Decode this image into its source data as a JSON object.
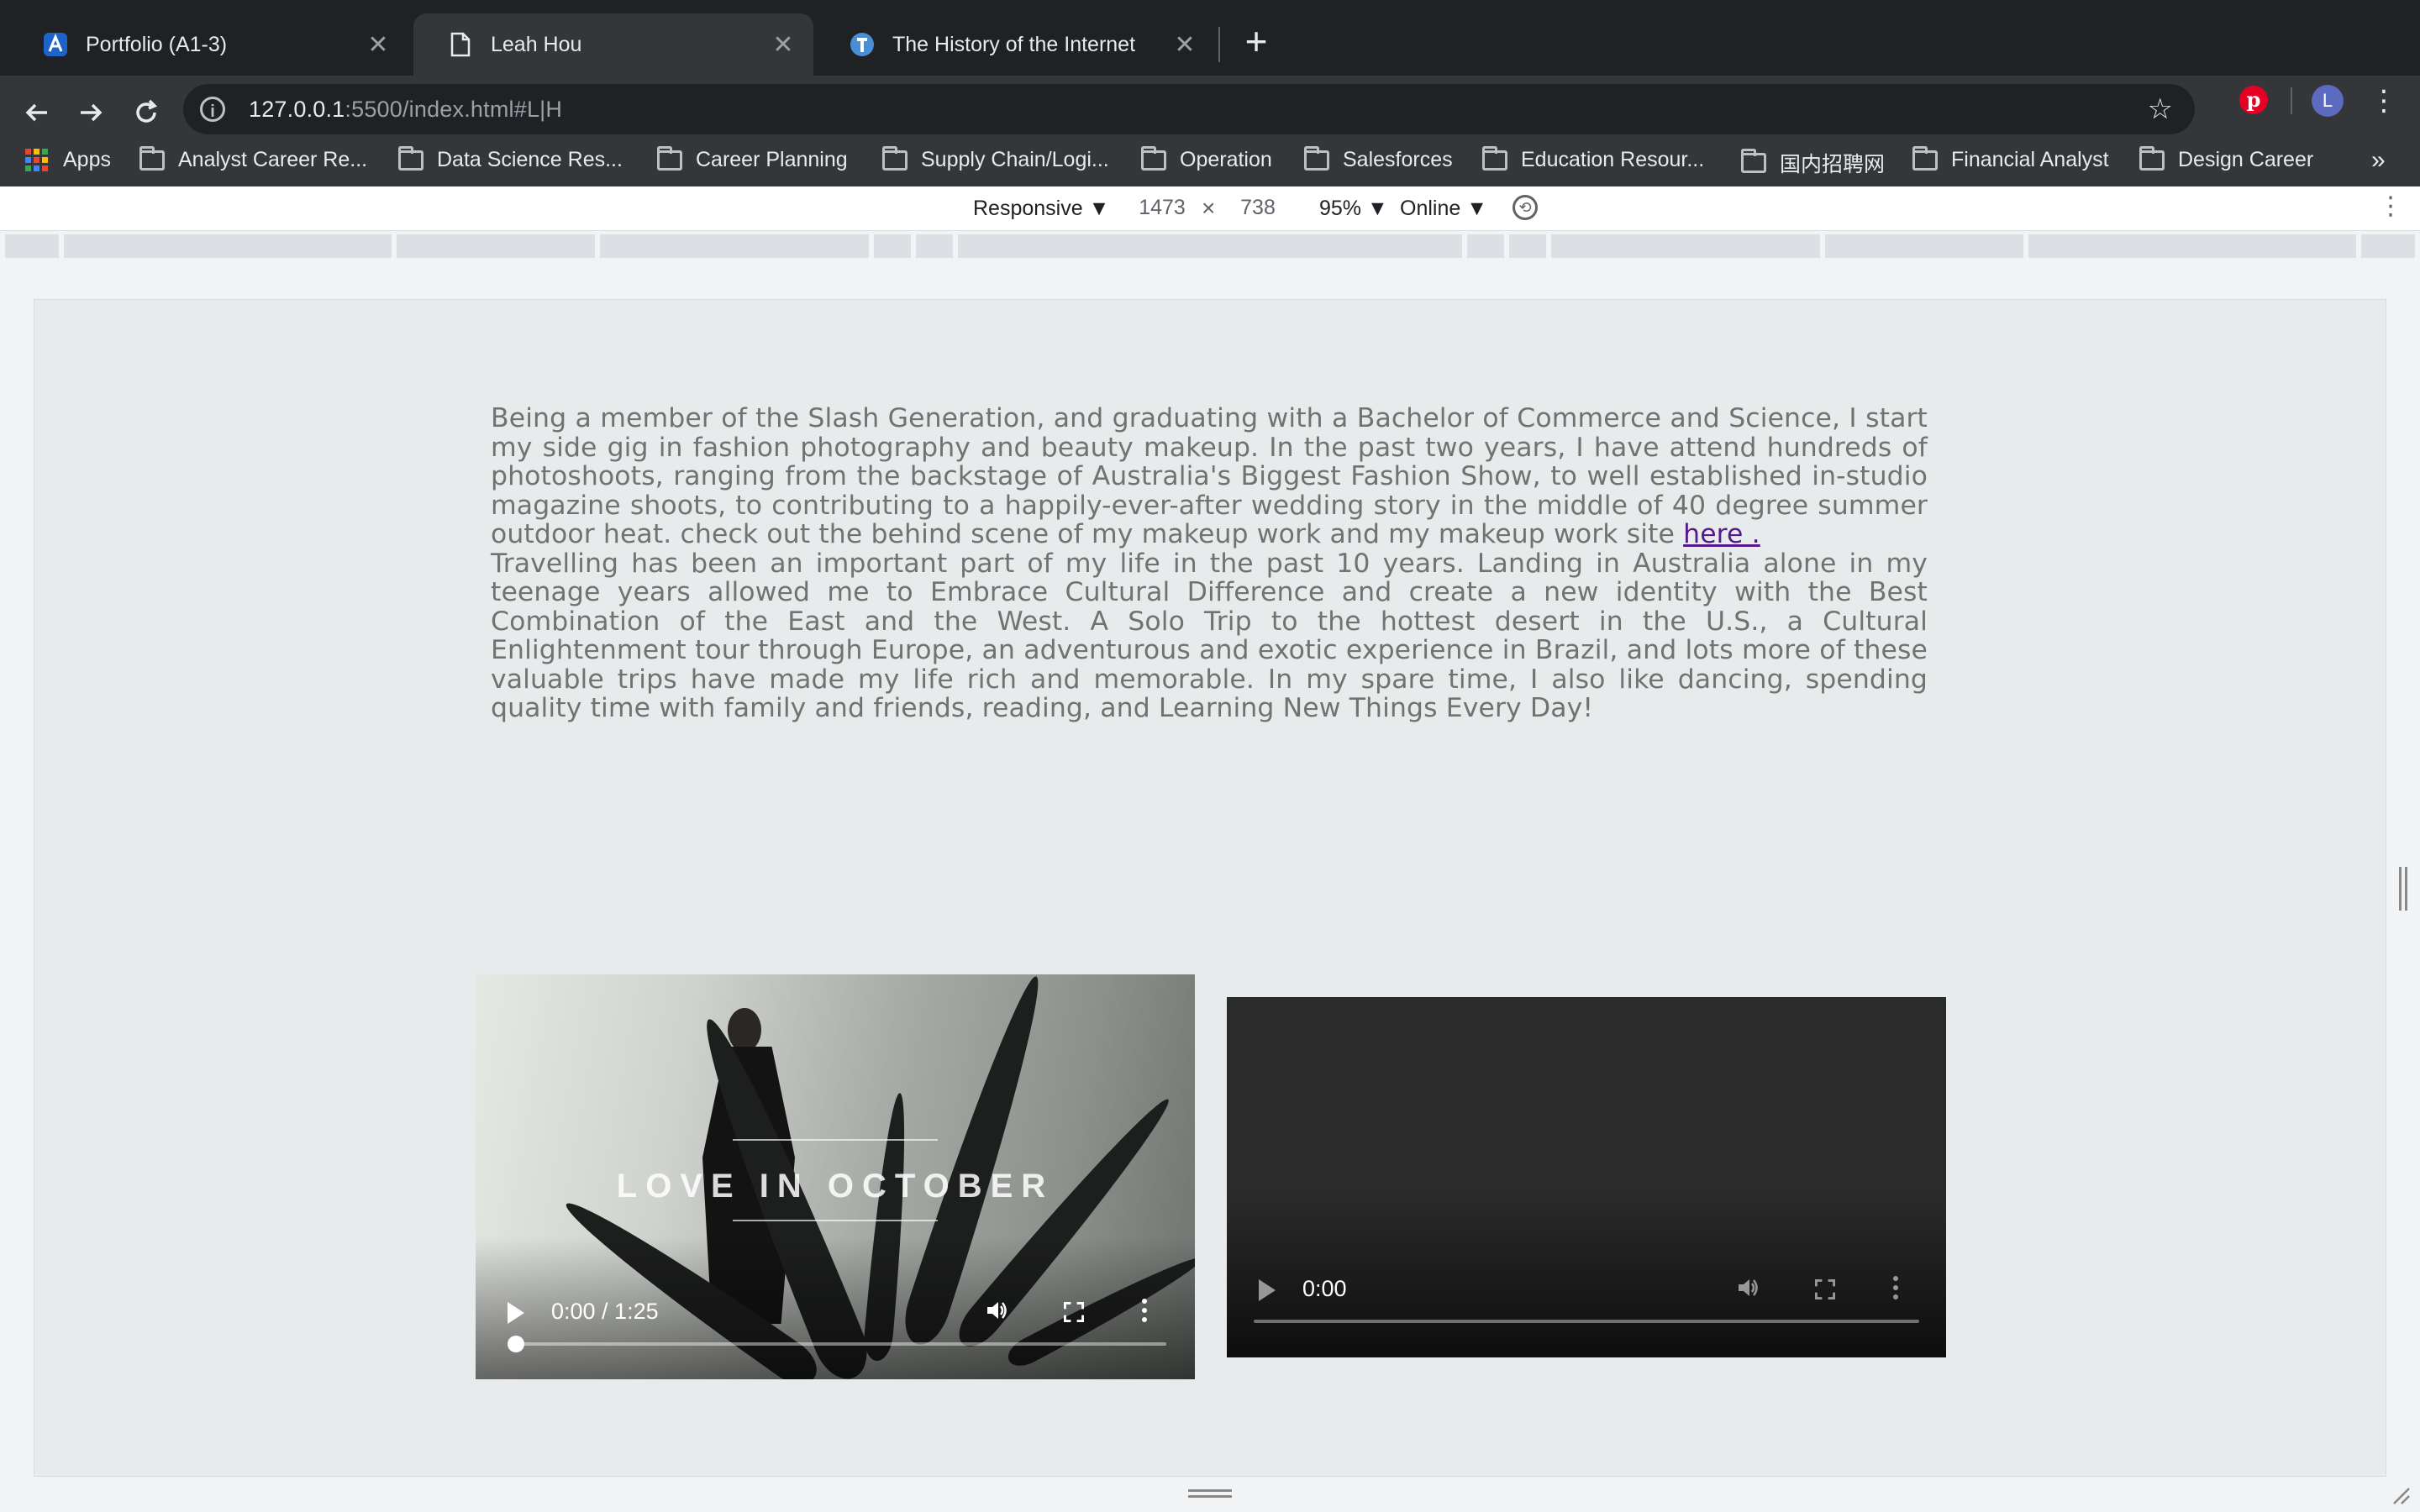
{
  "browser": {
    "tabs": [
      {
        "title": "Portfolio (A1-3)",
        "icon": "portfolio-favicon",
        "active": false
      },
      {
        "title": "Leah Hou",
        "icon": "document-icon",
        "active": true
      },
      {
        "title": "The History of the Internet",
        "icon": "site-favicon",
        "active": false
      }
    ],
    "url_host": "127.0.0.1",
    "url_rest": ":5500/index.html#L|H",
    "profile_initial": "L",
    "bookmarks": [
      {
        "label": "Apps",
        "icon": "apps-grid-icon"
      },
      {
        "label": "Analyst Career Re...",
        "icon": "folder-icon"
      },
      {
        "label": "Data Science Res...",
        "icon": "folder-icon"
      },
      {
        "label": "Career Planning",
        "icon": "folder-icon"
      },
      {
        "label": "Supply Chain/Logi...",
        "icon": "folder-icon"
      },
      {
        "label": "Operation",
        "icon": "folder-icon"
      },
      {
        "label": "Salesforces",
        "icon": "folder-icon"
      },
      {
        "label": "Education Resour...",
        "icon": "folder-icon"
      },
      {
        "label": "国内招聘网",
        "icon": "folder-icon"
      },
      {
        "label": "Financial Analyst",
        "icon": "folder-icon"
      },
      {
        "label": "Design Career",
        "icon": "folder-icon"
      }
    ],
    "bookmarks_more": "»"
  },
  "devtools": {
    "device": "Responsive ▼",
    "width": "1473",
    "times": "×",
    "height": "738",
    "zoom": "95% ▼",
    "network": "Online ▼"
  },
  "page": {
    "bio_p1": " Being a member of the Slash Generation, and graduating with a Bachelor of Commerce and Science, I start my side gig in fashion photography and beauty makeup. In the past two years, I have attend hundreds of photoshoots, ranging from the backstage of Australia's Biggest Fashion Show, to well established in-studio magazine shoots, to contributing to a happily-ever-after wedding story in the middle of 40 degree summer outdoor heat. check out the behind scene of my makeup work and my makeup work site ",
    "bio_link": "here .",
    "bio_p2": "Travelling has been an important part of my life in the past 10 years. Landing in Australia alone in my teenage years allowed me to Embrace Cultural Difference and create a new identity with the Best Combination of the East and the West. A Solo Trip to the hottest desert in the U.S., a Cultural Enlightenment tour through Europe, an adventurous and exotic experience in Brazil, and lots more of these valuable trips have made my life rich and memorable. In my spare time, I also like dancing, spending quality time with family and friends, reading, and Learning New Things Every Day!",
    "video1": {
      "overlay_title": "LOVE IN OCTOBER",
      "time": "0:00 / 1:25",
      "progress": 0.0
    },
    "video2": {
      "time": "0:00",
      "progress": 0.0
    }
  },
  "colors": {
    "tab_strip": "#202124",
    "toolbar": "#35363a",
    "page_bg": "#e8ebec",
    "bio_text": "#6d7471",
    "link": "#551a8b"
  }
}
